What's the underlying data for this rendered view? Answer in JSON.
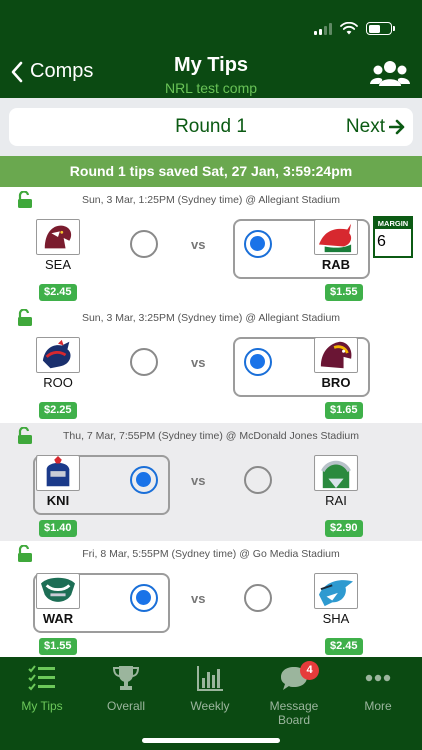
{
  "header": {
    "back_label": "Comps",
    "title": "My Tips",
    "subtitle": "NRL test comp"
  },
  "round": {
    "title": "Round 1",
    "next_label": "Next"
  },
  "saved_banner": "Round 1 tips saved Sat, 27 Jan, 3:59:24pm",
  "vs_label": "vs",
  "margin": {
    "label": "MARGIN",
    "value": "6"
  },
  "matches": [
    {
      "info": "Sun, 3 Mar, 1:25PM (Sydney time) @ Allegiant Stadium",
      "home": {
        "code": "SEA",
        "odds": "$2.45"
      },
      "away": {
        "code": "RAB",
        "odds": "$1.55"
      },
      "selected": "away"
    },
    {
      "info": "Sun, 3 Mar, 3:25PM (Sydney time) @ Allegiant Stadium",
      "home": {
        "code": "ROO",
        "odds": "$2.25"
      },
      "away": {
        "code": "BRO",
        "odds": "$1.65"
      },
      "selected": "away"
    },
    {
      "info": "Thu, 7 Mar, 7:55PM (Sydney time) @ McDonald Jones Stadium",
      "home": {
        "code": "KNI",
        "odds": "$1.40"
      },
      "away": {
        "code": "RAI",
        "odds": "$2.90"
      },
      "selected": "home"
    },
    {
      "info": "Fri, 8 Mar, 5:55PM (Sydney time) @ Go Media Stadium",
      "home": {
        "code": "WAR",
        "odds": "$1.55"
      },
      "away": {
        "code": "SHA",
        "odds": "$2.45"
      },
      "selected": "home"
    }
  ],
  "tabs": [
    {
      "label": "My Tips",
      "icon": "checklist-icon",
      "active": true
    },
    {
      "label": "Overall",
      "icon": "trophy-icon",
      "active": false
    },
    {
      "label": "Weekly",
      "icon": "bar-chart-icon",
      "active": false
    },
    {
      "label": "Message Board",
      "icon": "chat-bubble-icon",
      "active": false,
      "badge": "4"
    },
    {
      "label": "More",
      "icon": "more-dots-icon",
      "active": false
    }
  ],
  "colors": {
    "header_green": "#0b4a12",
    "accent_green": "#6aa84f",
    "odds_green": "#3fb04a",
    "radio_blue": "#1a73e8",
    "badge_red": "#e53b3b"
  }
}
